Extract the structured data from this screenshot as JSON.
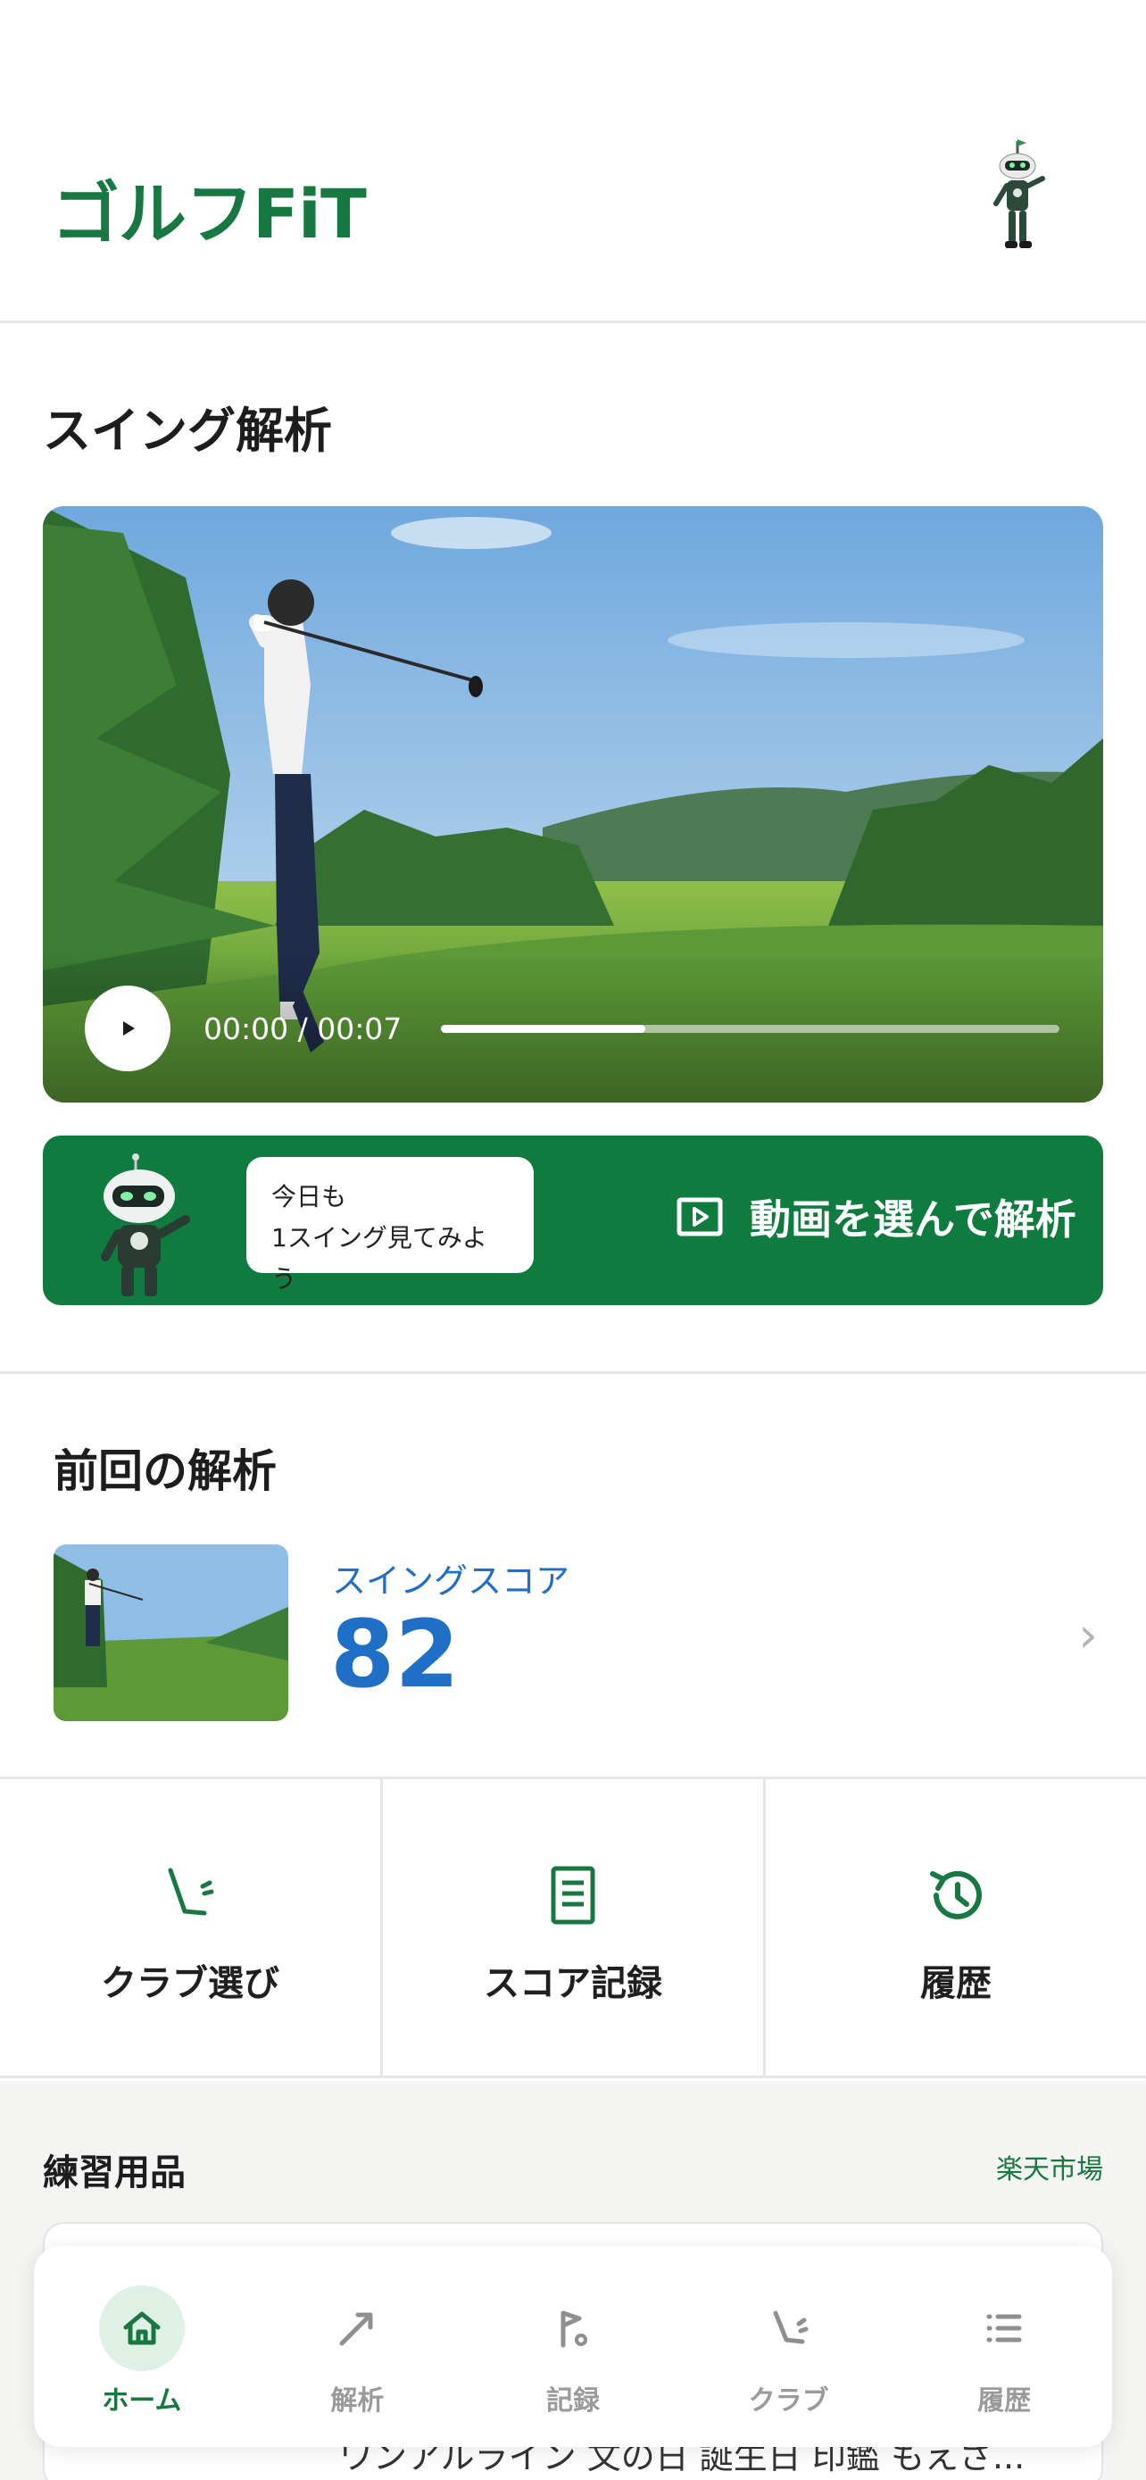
{
  "app": {
    "title": "ゴルフFiT"
  },
  "swing": {
    "title": "スイング解析",
    "video": {
      "time": "00:00 / 00:07",
      "progress": 0.33
    }
  },
  "cta": {
    "bubble_line1": "今日も",
    "bubble_line2": "1スイング見てみよう",
    "button_label": "動画を選んで解析"
  },
  "last": {
    "title": "前回の解析",
    "score_label": "スイングスコア",
    "score": "82"
  },
  "quick_actions": [
    {
      "label": "クラブ選び",
      "icon": "club-icon"
    },
    {
      "label": "スコア記録",
      "icon": "scorecard-icon"
    },
    {
      "label": "履歴",
      "icon": "history-icon"
    }
  ],
  "goods": {
    "title": "練習用品",
    "link": "楽天市場",
    "item_text": "ワンアルライン 文の日 誕生日 印鑑 もえさ..."
  },
  "tabs": [
    {
      "label": "ホーム",
      "icon": "home-icon",
      "active": true
    },
    {
      "label": "解析",
      "icon": "analysis-icon",
      "active": false
    },
    {
      "label": "記録",
      "icon": "flag-icon",
      "active": false
    },
    {
      "label": "クラブ",
      "icon": "club-icon",
      "active": false
    },
    {
      "label": "履歴",
      "icon": "list-icon",
      "active": false
    }
  ],
  "colors": {
    "brand_green": "#177842",
    "cta_green": "#0f7b3f",
    "score_blue": "#1f6fc6"
  }
}
